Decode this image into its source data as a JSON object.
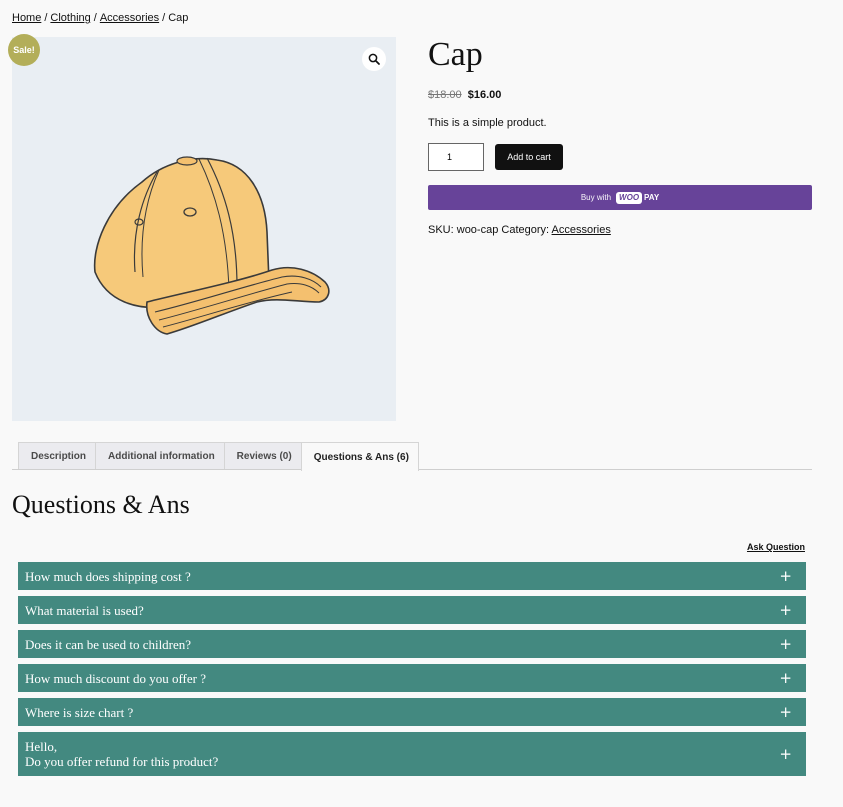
{
  "breadcrumb": {
    "items": [
      "Home",
      "Clothing",
      "Accessories"
    ],
    "separator": "/",
    "current": "Cap"
  },
  "gallery": {
    "sale_badge": "Sale!",
    "zoom_icon": "magnifier-icon",
    "image": "yellow-cap-illustration"
  },
  "product": {
    "title": "Cap",
    "price_old": "$18.00",
    "price_new": "$16.00",
    "short_description": "This is a simple product.",
    "quantity": "1",
    "add_to_cart_label": "Add to cart",
    "woopay_prefix": "Buy with",
    "woopay_brand_woo": "WOO",
    "woopay_brand_pay": "PAY",
    "sku_label": "SKU:",
    "sku": "woo-cap",
    "category_label": "Category:",
    "category": "Accessories"
  },
  "tabs": [
    {
      "label": "Description",
      "active": false
    },
    {
      "label": "Additional information",
      "active": false
    },
    {
      "label": "Reviews (0)",
      "active": false
    },
    {
      "label": "Questions & Ans (6)",
      "active": true
    }
  ],
  "qa": {
    "heading": "Questions & Ans",
    "ask_label": "Ask Question",
    "expand_icon": "plus-icon",
    "items": [
      "How much does shipping cost ?",
      "What material is used?",
      "Does it can be used to children?",
      "How much discount do you offer ?",
      "Where is size chart ?",
      "Hello,\nDo you offer refund for this product?"
    ],
    "plus_glyph": "+"
  },
  "colors": {
    "sale_badge": "#b3ae59",
    "woopay": "#674399",
    "faq_bar": "#438980",
    "page_bg": "#f9f9f9",
    "gallery_bg": "#e9eef3"
  }
}
